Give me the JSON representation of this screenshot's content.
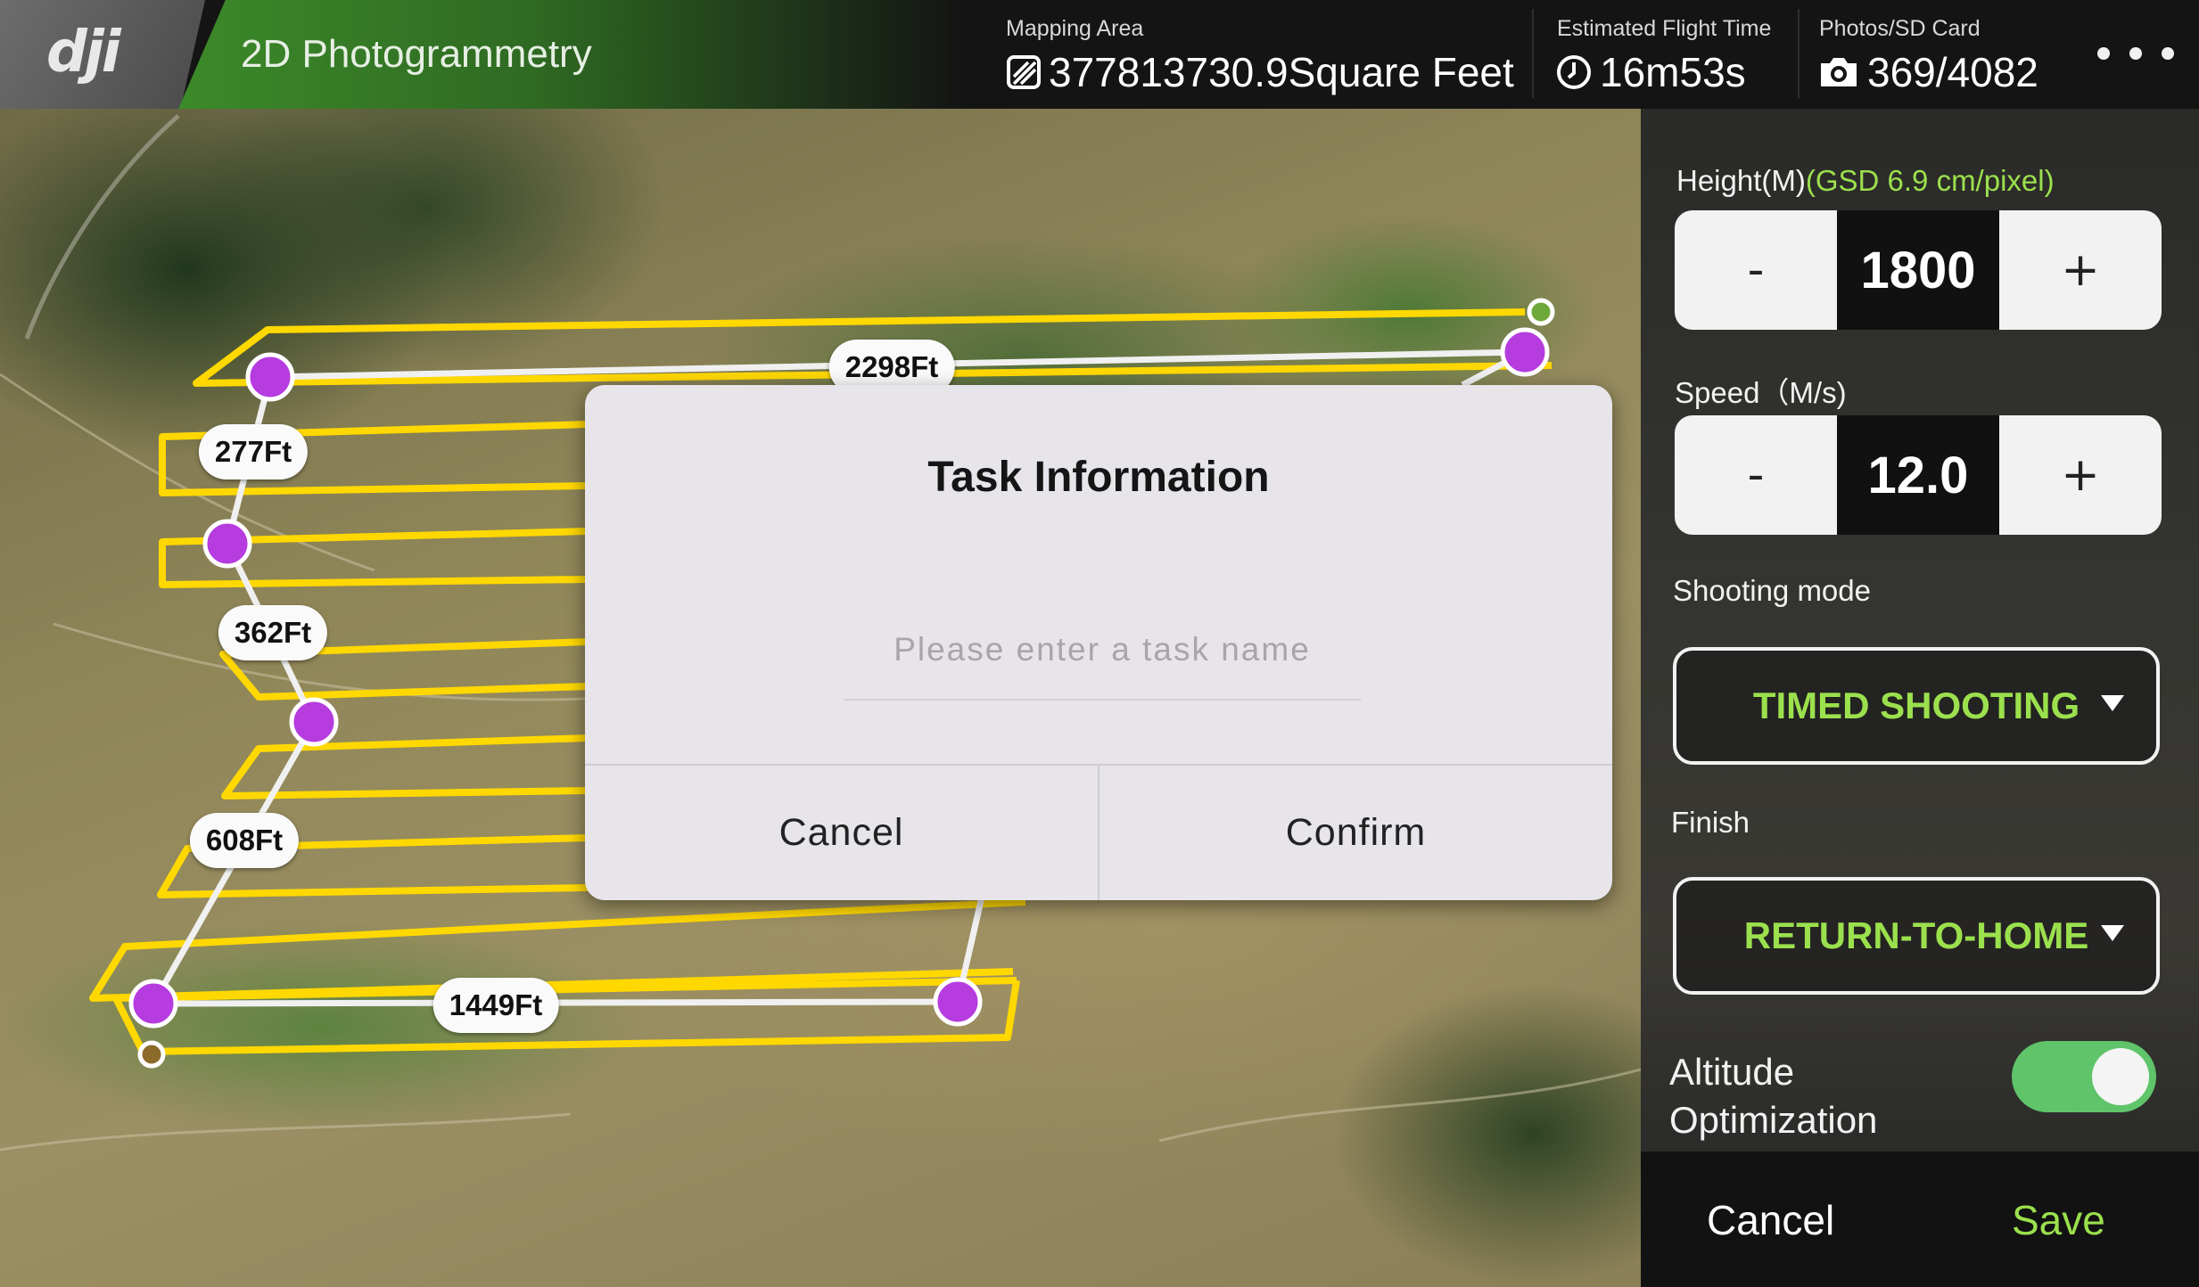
{
  "header": {
    "logo": "dji",
    "mode_title": "2D Photogrammetry",
    "mapping_area": {
      "label": "Mapping Area",
      "value": "377813730.9Square Feet",
      "icon": "area-hatch-icon"
    },
    "flight_time": {
      "label": "Estimated Flight Time",
      "value": "16m53s",
      "icon": "clock-icon"
    },
    "photos": {
      "label": "Photos/SD Card",
      "value": "369/4082",
      "icon": "camera-icon"
    },
    "more_icon": "more-horizontal-icon"
  },
  "map": {
    "distances": [
      "2298Ft",
      "277Ft",
      "362Ft",
      "608Ft",
      "1449Ft"
    ],
    "colors": {
      "path": "#ffd800",
      "waypoint": "#b63ce0",
      "route": "#f0f0f0"
    }
  },
  "panel": {
    "height": {
      "label": "Height(M)",
      "gsd": "(GSD  6.9 cm/pixel)",
      "value": "1800",
      "minus": "-",
      "plus": "+"
    },
    "speed": {
      "label": "Speed（M/s)",
      "value": "12.0",
      "minus": "-",
      "plus": "+"
    },
    "shooting_mode": {
      "label": "Shooting mode",
      "value": "TIMED SHOOTING"
    },
    "finish": {
      "label": "Finish",
      "value": "RETURN-TO-HOME"
    },
    "altitude_optimization": {
      "label_line1": "Altitude",
      "label_line2": "Optimization",
      "on": true
    },
    "footer": {
      "cancel": "Cancel",
      "save": "Save"
    },
    "colors": {
      "accent": "#9be04d",
      "toggle_on": "#5fc46a"
    }
  },
  "dialog": {
    "title": "Task Information",
    "input_placeholder": "Please enter a task name",
    "input_value": "",
    "cancel": "Cancel",
    "confirm": "Confirm"
  }
}
